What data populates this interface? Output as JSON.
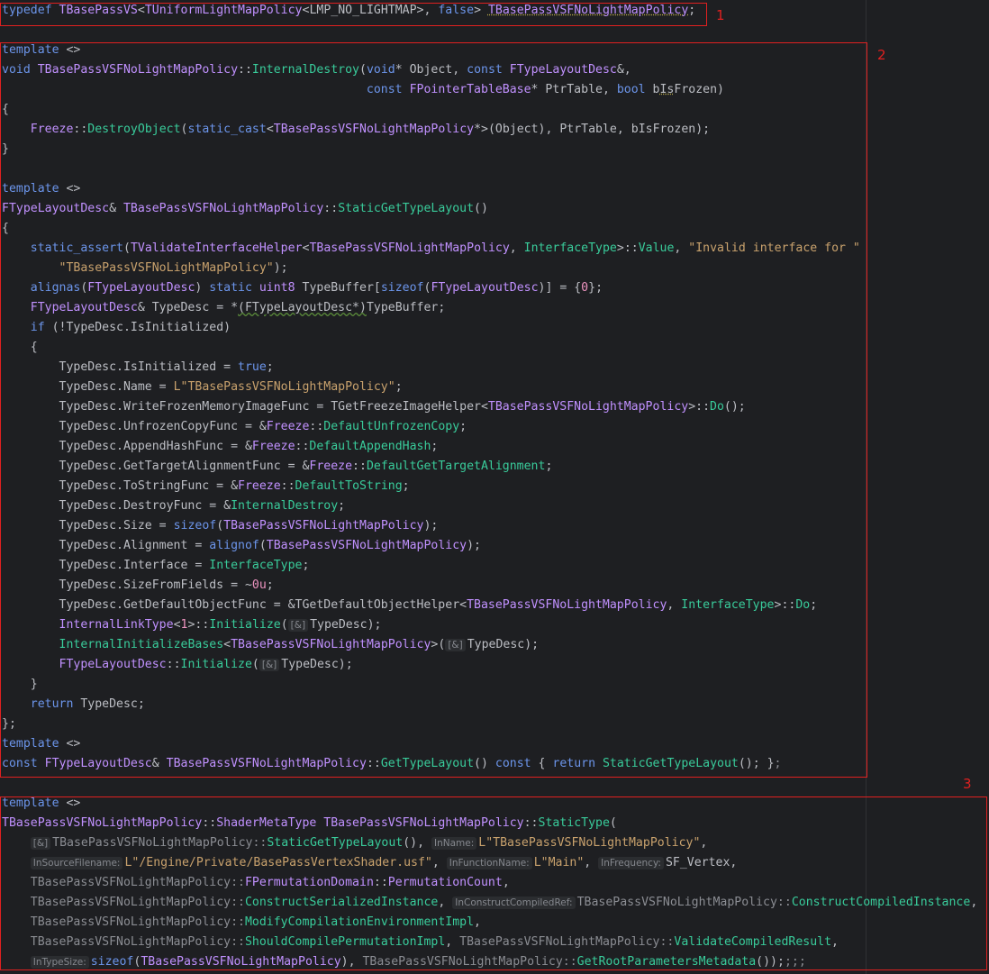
{
  "code": {
    "lines": [
      [
        [
          "typedef ",
          "kw"
        ],
        [
          "TBasePassVS",
          "ty"
        ],
        [
          "<",
          ""
        ],
        [
          "TUniformLightMapPolicy",
          "ty"
        ],
        [
          "<LMP_NO_LIGHTMAP>, ",
          ""
        ],
        [
          "false",
          "kw"
        ],
        [
          "> ",
          ""
        ],
        [
          "TBasePassVSFNoLightMapPolicy",
          "ty warn"
        ],
        [
          ";",
          ""
        ]
      ],
      [],
      [
        [
          "template ",
          "kw"
        ],
        [
          "<>",
          ""
        ]
      ],
      [
        [
          "void ",
          "kw"
        ],
        [
          "TBasePassVSFNoLightMapPolicy",
          "ty"
        ],
        [
          "::",
          ""
        ],
        [
          "InternalDestroy",
          "fn"
        ],
        [
          "(",
          ""
        ],
        [
          "void",
          "kw"
        ],
        [
          "* Object, ",
          ""
        ],
        [
          "const ",
          "kw"
        ],
        [
          "FTypeLayoutDesc",
          "ty"
        ],
        [
          "&,",
          ""
        ]
      ],
      [
        [
          "                                                   ",
          ""
        ],
        [
          "const ",
          "kw"
        ],
        [
          "FPointerTableBase",
          "ty"
        ],
        [
          "* PtrTable, ",
          ""
        ],
        [
          "bool ",
          "kw"
        ],
        [
          "b",
          ""
        ],
        [
          "Is",
          "warn"
        ],
        [
          "Frozen)",
          ""
        ]
      ],
      [
        [
          "{",
          ""
        ]
      ],
      [
        [
          "    ",
          ""
        ],
        [
          "Freeze",
          "ty"
        ],
        [
          "::",
          ""
        ],
        [
          "DestroyObject",
          "fn"
        ],
        [
          "(",
          ""
        ],
        [
          "static_cast",
          "kw"
        ],
        [
          "<",
          ""
        ],
        [
          "TBasePassVSFNoLightMapPolicy",
          "ty"
        ],
        [
          "*>(Object), PtrTable, bIsFrozen);",
          ""
        ]
      ],
      [
        [
          "}",
          ""
        ]
      ],
      [],
      [
        [
          "template ",
          "kw"
        ],
        [
          "<>",
          ""
        ]
      ],
      [
        [
          "FTypeLayoutDesc",
          "ty"
        ],
        [
          "& ",
          ""
        ],
        [
          "TBasePassVSFNoLightMapPolicy",
          "ty"
        ],
        [
          "::",
          ""
        ],
        [
          "StaticGetTypeLayout",
          "fn"
        ],
        [
          "()",
          ""
        ]
      ],
      [
        [
          "{",
          ""
        ]
      ],
      [
        [
          "    ",
          ""
        ],
        [
          "static_assert",
          "kw"
        ],
        [
          "(",
          ""
        ],
        [
          "TValidateInterfaceHelper",
          "ty"
        ],
        [
          "<",
          ""
        ],
        [
          "TBasePassVSFNoLightMapPolicy",
          "ty"
        ],
        [
          ", ",
          ""
        ],
        [
          "InterfaceType",
          "fn"
        ],
        [
          ">::",
          ""
        ],
        [
          "Value",
          "fn"
        ],
        [
          ", ",
          ""
        ],
        [
          "\"Invalid interface for \"",
          "str"
        ]
      ],
      [
        [
          "        ",
          ""
        ],
        [
          "\"TBasePassVSFNoLightMapPolicy\"",
          "str"
        ],
        [
          ");",
          ""
        ]
      ],
      [
        [
          "    ",
          ""
        ],
        [
          "alignas",
          "kw"
        ],
        [
          "(",
          ""
        ],
        [
          "FTypeLayoutDesc",
          "ty"
        ],
        [
          ") ",
          ""
        ],
        [
          "static ",
          "kw"
        ],
        [
          "uint8 ",
          "ty"
        ],
        [
          "TypeBuffer[",
          ""
        ],
        [
          "sizeof",
          "kw"
        ],
        [
          "(",
          ""
        ],
        [
          "FTypeLayoutDesc",
          "ty"
        ],
        [
          ")] = {",
          ""
        ],
        [
          "0",
          "num"
        ],
        [
          "};",
          ""
        ]
      ],
      [
        [
          "    ",
          ""
        ],
        [
          "FTypeLayoutDesc",
          "ty"
        ],
        [
          "& TypeDesc = *",
          ""
        ],
        [
          "(FTypeLayoutDesc*)",
          "wavy"
        ],
        [
          "TypeBuffer;",
          ""
        ]
      ],
      [
        [
          "    ",
          ""
        ],
        [
          "if ",
          "kw"
        ],
        [
          "(!TypeDesc.IsInitialized)",
          ""
        ]
      ],
      [
        [
          "    {",
          ""
        ]
      ],
      [
        [
          "        TypeDesc.IsInitialized = ",
          ""
        ],
        [
          "true",
          "kw"
        ],
        [
          ";",
          ""
        ]
      ],
      [
        [
          "        TypeDesc.Name = ",
          ""
        ],
        [
          "L\"TBasePassVSFNoLightMapPolicy\"",
          "str"
        ],
        [
          ";",
          ""
        ]
      ],
      [
        [
          "        TypeDesc.WriteFrozenMemoryImageFunc = TGetFreezeImageHelper<",
          ""
        ],
        [
          "TBasePassVSFNoLightMapPolicy",
          "ty"
        ],
        [
          ">::",
          ""
        ],
        [
          "Do",
          "fn"
        ],
        [
          "();",
          ""
        ]
      ],
      [
        [
          "        TypeDesc.UnfrozenCopyFunc = &",
          ""
        ],
        [
          "Freeze",
          "ty"
        ],
        [
          "::",
          ""
        ],
        [
          "DefaultUnfrozenCopy",
          "fn"
        ],
        [
          ";",
          ""
        ]
      ],
      [
        [
          "        TypeDesc.AppendHashFunc = &",
          ""
        ],
        [
          "Freeze",
          "ty"
        ],
        [
          "::",
          ""
        ],
        [
          "DefaultAppendHash",
          "fn"
        ],
        [
          ";",
          ""
        ]
      ],
      [
        [
          "        TypeDesc.GetTargetAlignmentFunc = &",
          ""
        ],
        [
          "Freeze",
          "ty"
        ],
        [
          "::",
          ""
        ],
        [
          "DefaultGetTargetAlignment",
          "fn"
        ],
        [
          ";",
          ""
        ]
      ],
      [
        [
          "        TypeDesc.ToStringFunc = &",
          ""
        ],
        [
          "Freeze",
          "ty"
        ],
        [
          "::",
          ""
        ],
        [
          "DefaultToString",
          "fn"
        ],
        [
          ";",
          ""
        ]
      ],
      [
        [
          "        TypeDesc.DestroyFunc = &",
          ""
        ],
        [
          "InternalDestroy",
          "fn"
        ],
        [
          ";",
          ""
        ]
      ],
      [
        [
          "        TypeDesc.Size = ",
          ""
        ],
        [
          "sizeof",
          "kw"
        ],
        [
          "(",
          ""
        ],
        [
          "TBasePassVSFNoLightMapPolicy",
          "ty"
        ],
        [
          ");",
          ""
        ]
      ],
      [
        [
          "        TypeDesc.Alignment = ",
          ""
        ],
        [
          "alignof",
          "kw"
        ],
        [
          "(",
          ""
        ],
        [
          "TBasePassVSFNoLightMapPolicy",
          "ty"
        ],
        [
          ");",
          ""
        ]
      ],
      [
        [
          "        TypeDesc.Interface = ",
          ""
        ],
        [
          "InterfaceType",
          "fn"
        ],
        [
          ";",
          ""
        ]
      ],
      [
        [
          "        TypeDesc.SizeFromFields = ~",
          ""
        ],
        [
          "0u",
          "num"
        ],
        [
          ";",
          ""
        ]
      ],
      [
        [
          "        TypeDesc.GetDefaultObjectFunc = &TGetDefaultObjectHelper<",
          ""
        ],
        [
          "TBasePassVSFNoLightMapPolicy",
          "ty"
        ],
        [
          ", ",
          ""
        ],
        [
          "InterfaceType",
          "fn"
        ],
        [
          ">::",
          ""
        ],
        [
          "Do",
          "fn"
        ],
        [
          ";",
          ""
        ]
      ],
      [
        [
          "        ",
          ""
        ],
        [
          "InternalLinkType",
          "ty"
        ],
        [
          "<",
          ""
        ],
        [
          "1",
          "num"
        ],
        [
          ">::",
          ""
        ],
        [
          "Initialize",
          "fn"
        ],
        [
          "(",
          ""
        ],
        [
          "[&]",
          "hint"
        ],
        [
          "TypeDesc);",
          ""
        ]
      ],
      [
        [
          "        ",
          ""
        ],
        [
          "InternalInitializeBases",
          "fn"
        ],
        [
          "<",
          ""
        ],
        [
          "TBasePassVSFNoLightMapPolicy",
          "ty"
        ],
        [
          ">(",
          ""
        ],
        [
          "[&]",
          "hint"
        ],
        [
          "TypeDesc);",
          ""
        ]
      ],
      [
        [
          "        ",
          ""
        ],
        [
          "FTypeLayoutDesc",
          "ty"
        ],
        [
          "::",
          ""
        ],
        [
          "Initialize",
          "fn"
        ],
        [
          "(",
          ""
        ],
        [
          "[&]",
          "hint"
        ],
        [
          "TypeDesc);",
          ""
        ]
      ],
      [
        [
          "    }",
          ""
        ]
      ],
      [
        [
          "    ",
          ""
        ],
        [
          "return ",
          "kw"
        ],
        [
          "TypeDesc;",
          ""
        ]
      ],
      [
        [
          "};",
          ""
        ]
      ],
      [
        [
          "template ",
          "kw"
        ],
        [
          "<>",
          ""
        ]
      ],
      [
        [
          "const ",
          "kw"
        ],
        [
          "FTypeLayoutDesc",
          "ty"
        ],
        [
          "& ",
          ""
        ],
        [
          "TBasePassVSFNoLightMapPolicy",
          "ty"
        ],
        [
          "::",
          ""
        ],
        [
          "GetTypeLayout",
          "fn"
        ],
        [
          "() ",
          ""
        ],
        [
          "const ",
          "kw"
        ],
        [
          "{ ",
          ""
        ],
        [
          "return ",
          "kw"
        ],
        [
          "StaticGetTypeLayout",
          "fn"
        ],
        [
          "(); }",
          ""
        ],
        [
          ";",
          "df"
        ]
      ],
      [],
      [
        [
          "template ",
          "kw"
        ],
        [
          "<>",
          ""
        ]
      ],
      [
        [
          "TBasePassVSFNoLightMapPolicy",
          "ty"
        ],
        [
          "::",
          ""
        ],
        [
          "ShaderMetaType ",
          "ty"
        ],
        [
          "TBasePassVSFNoLightMapPolicy",
          "ty"
        ],
        [
          "::",
          ""
        ],
        [
          "StaticType",
          "fn"
        ],
        [
          "(",
          ""
        ]
      ],
      [
        [
          "    ",
          ""
        ],
        [
          "[&]",
          "hint"
        ],
        [
          "TBasePassVSFNoLightMapPolicy",
          "df"
        ],
        [
          "::",
          "df"
        ],
        [
          "StaticGetTypeLayout",
          "fn"
        ],
        [
          "(), ",
          ""
        ],
        [
          "InName:",
          "hint"
        ],
        [
          "L\"TBasePassVSFNoLightMapPolicy\"",
          "str"
        ],
        [
          ",",
          ""
        ]
      ],
      [
        [
          "    ",
          ""
        ],
        [
          "InSourceFilename:",
          "hint"
        ],
        [
          "L\"/Engine/Private/BasePassVertexShader.usf\"",
          "str"
        ],
        [
          ", ",
          ""
        ],
        [
          "InFunctionName:",
          "hint"
        ],
        [
          "L\"Main\"",
          "str"
        ],
        [
          ", ",
          ""
        ],
        [
          "InFrequency:",
          "hint"
        ],
        [
          "SF_Vertex",
          ""
        ],
        [
          ",",
          ""
        ]
      ],
      [
        [
          "    ",
          ""
        ],
        [
          "TBasePassVSFNoLightMapPolicy",
          "df"
        ],
        [
          "::",
          "df"
        ],
        [
          "FPermutationDomain",
          "ty"
        ],
        [
          "::",
          ""
        ],
        [
          "PermutationCount",
          "ty"
        ],
        [
          ",",
          ""
        ]
      ],
      [
        [
          "    ",
          ""
        ],
        [
          "TBasePassVSFNoLightMapPolicy",
          "df"
        ],
        [
          "::",
          "df"
        ],
        [
          "ConstructSerializedInstance",
          "fn"
        ],
        [
          ", ",
          ""
        ],
        [
          "InConstructCompiledRef:",
          "hint"
        ],
        [
          "TBasePassVSFNoLightMapPolicy",
          "df"
        ],
        [
          "::",
          "df"
        ],
        [
          "ConstructCompiledInstance",
          "fn"
        ],
        [
          ",",
          ""
        ]
      ],
      [
        [
          "    ",
          ""
        ],
        [
          "TBasePassVSFNoLightMapPolicy",
          "df"
        ],
        [
          "::",
          "df"
        ],
        [
          "ModifyCompilationEnvironmentImpl",
          "fn"
        ],
        [
          ",",
          ""
        ]
      ],
      [
        [
          "    ",
          ""
        ],
        [
          "TBasePassVSFNoLightMapPolicy",
          "df"
        ],
        [
          "::",
          "df"
        ],
        [
          "ShouldCompilePermutationImpl",
          "fn"
        ],
        [
          ", ",
          ""
        ],
        [
          "TBasePassVSFNoLightMapPolicy",
          "df"
        ],
        [
          "::",
          "df"
        ],
        [
          "ValidateCompiledResult",
          "fn"
        ],
        [
          ",",
          ""
        ]
      ],
      [
        [
          "    ",
          ""
        ],
        [
          "InTypeSize:",
          "hint"
        ],
        [
          "sizeof",
          "kw"
        ],
        [
          "(",
          ""
        ],
        [
          "TBasePassVSFNoLightMapPolicy",
          "ty"
        ],
        [
          "), ",
          ""
        ],
        [
          "TBasePassVSFNoLightMapPolicy",
          "df"
        ],
        [
          "::",
          "df"
        ],
        [
          "GetRootParametersMetadata",
          "fn"
        ],
        [
          "());",
          ""
        ],
        [
          ";;;",
          "df"
        ]
      ]
    ]
  },
  "annotations": [
    {
      "label": "1"
    },
    {
      "label": "2"
    },
    {
      "label": "3"
    }
  ]
}
